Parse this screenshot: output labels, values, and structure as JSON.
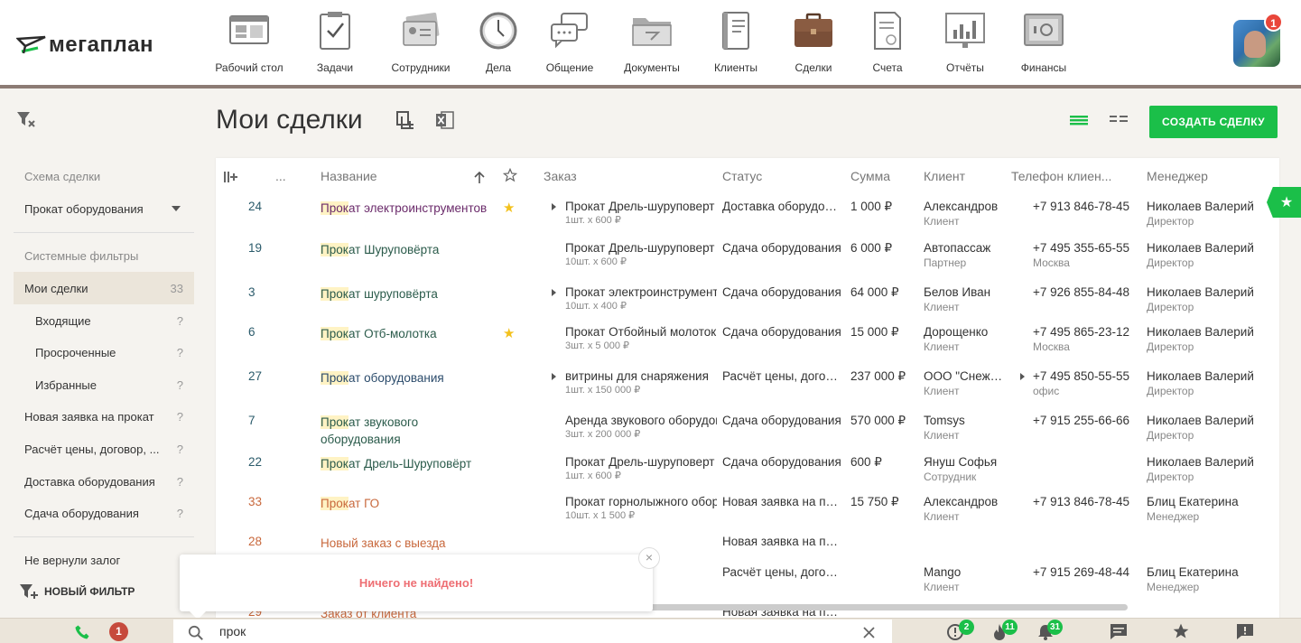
{
  "brand": {
    "logo_text": "мегаплан"
  },
  "nav": [
    {
      "label": "Рабочий стол",
      "icon": "desktop-icon"
    },
    {
      "label": "Задачи",
      "icon": "tasks-icon"
    },
    {
      "label": "Сотрудники",
      "icon": "employees-icon"
    },
    {
      "label": "Дела",
      "icon": "clock-icon"
    },
    {
      "label": "Общение",
      "icon": "chat-icon"
    },
    {
      "label": "Документы",
      "icon": "folder-icon"
    },
    {
      "label": "Клиенты",
      "icon": "contacts-book-icon"
    },
    {
      "label": "Сделки",
      "icon": "briefcase-icon",
      "active": true
    },
    {
      "label": "Счета",
      "icon": "invoice-icon"
    },
    {
      "label": "Отчёты",
      "icon": "report-chart-icon"
    },
    {
      "label": "Финансы",
      "icon": "safe-icon"
    }
  ],
  "user": {
    "notifications": "1"
  },
  "sidebar": {
    "scheme_label": "Схема сделки",
    "scheme_value": "Прокат оборудования",
    "system_filters_label": "Системные фильтры",
    "items": [
      {
        "label": "Мои сделки",
        "count": "33"
      },
      {
        "label": "Входящие",
        "count": "?"
      },
      {
        "label": "Просроченные",
        "count": "?"
      },
      {
        "label": "Избранные",
        "count": "?"
      },
      {
        "label": "Новая заявка на прокат",
        "count": "?"
      },
      {
        "label": "Расчёт цены, договор, ...",
        "count": "?"
      },
      {
        "label": "Доставка оборудования",
        "count": "?"
      },
      {
        "label": "Сдача оборудования",
        "count": "?"
      },
      {
        "label": "Не вернули залог",
        "count": "?"
      }
    ],
    "new_filter": "НОВЫЙ ФИЛЬТР"
  },
  "main": {
    "title": "Мои сделки",
    "create_button": "СОЗДАТЬ СДЕЛКУ"
  },
  "table": {
    "headers": {
      "more": "...",
      "name": "Название",
      "order": "Заказ",
      "status": "Статус",
      "sum": "Сумма",
      "client": "Клиент",
      "phone": "Телефон клиен...",
      "manager": "Менеджер"
    },
    "rows": [
      {
        "id": "24",
        "name_hl": "Прок",
        "name_rest": "ат электроинструментов",
        "name_color": "#6a2a6a",
        "starred": true,
        "order_arrow": true,
        "order": "Прокат Дрель-шуруповерт",
        "order_qty": "1шт. x 600 ₽",
        "status": "Доставка оборудования",
        "sum": "1 000 ₽",
        "client": "Александров",
        "client_type": "Клиент",
        "phone_arrow": false,
        "phone": "+7 913 846-78-45",
        "phone_type": "",
        "manager": "Николаев Валерий",
        "manager_role": "Директор"
      },
      {
        "id": "19",
        "name_hl": "Прок",
        "name_rest": "ат Шуруповёрта",
        "name_color": "#2b5b4b",
        "starred": false,
        "order_arrow": false,
        "order": "Прокат Дрель-шуруповерт",
        "order_qty": "10шт. x 600 ₽",
        "status": "Сдача оборудования",
        "sum": "6 000 ₽",
        "client": "Автопассаж",
        "client_type": "Партнер",
        "phone_arrow": false,
        "phone": "+7 495 355-65-55",
        "phone_type": "Москва",
        "manager": "Николаев Валерий",
        "manager_role": "Директор"
      },
      {
        "id": "3",
        "name_hl": "Прок",
        "name_rest": "ат шуруповёрта",
        "name_color": "#2b5b4b",
        "starred": false,
        "order_arrow": true,
        "order": "Прокат электроинструмента",
        "order_qty": "10шт. x 400 ₽",
        "status": "Сдача оборудования",
        "sum": "64 000 ₽",
        "client": "Белов Иван",
        "client_type": "Клиент",
        "phone_arrow": false,
        "phone": "+7 926 855-84-48",
        "phone_type": "",
        "manager": "Николаев Валерий",
        "manager_role": "Директор"
      },
      {
        "id": "6",
        "name_hl": "Прок",
        "name_rest": "ат Отб-молотка",
        "name_color": "#2b5b4b",
        "starred": true,
        "order_arrow": false,
        "order": "Прокат Отбойный молоток",
        "order_qty": "3шт. x 5 000 ₽",
        "status": "Сдача оборудования",
        "sum": "15 000 ₽",
        "client": "Дорощенко",
        "client_type": "Клиент",
        "phone_arrow": false,
        "phone": "+7 495 865-23-12",
        "phone_type": "Москва",
        "manager": "Николаев Валерий",
        "manager_role": "Директор"
      },
      {
        "id": "27",
        "name_hl": "Прок",
        "name_rest": "ат оборудования",
        "name_color": "#2b4b6b",
        "starred": false,
        "order_arrow": true,
        "order": "витрины для снаряжения",
        "order_qty": "1шт. x 150 000 ₽",
        "status": "Расчёт цены, договор",
        "sum": "237 000 ₽",
        "client": "ООО \"Снежок\"",
        "client_type": "Клиент",
        "phone_arrow": true,
        "phone": "+7 495 850-55-55",
        "phone_type": "офис",
        "manager": "Николаев Валерий",
        "manager_role": "Директор"
      },
      {
        "id": "7",
        "name_hl": "Прок",
        "name_rest": "ат звукового оборудования",
        "name_color": "#2b5b4b",
        "starred": false,
        "order_arrow": false,
        "order": "Аренда звукового оборудования",
        "order_qty": "3шт. x 200 000 ₽",
        "status": "Сдача оборудования",
        "sum": "570 000 ₽",
        "client": "Tomsys",
        "client_type": "Клиент",
        "phone_arrow": false,
        "phone": "+7 915 255-66-66",
        "phone_type": "",
        "manager": "Николаев Валерий",
        "manager_role": "Директор"
      },
      {
        "id": "22",
        "name_hl": "Прок",
        "name_rest": "ат Дрель-Шуруповёрт",
        "name_color": "#2b5b4b",
        "starred": false,
        "order_arrow": false,
        "order": "Прокат Дрель-шуруповерт",
        "order_qty": "1шт. x 600 ₽",
        "status": "Сдача оборудования",
        "sum": "600 ₽",
        "client": "Януш Софья",
        "client_type": "Сотрудник",
        "phone_arrow": false,
        "phone": "",
        "phone_type": "",
        "manager": "Николаев Валерий",
        "manager_role": "Директор"
      },
      {
        "id": "33",
        "name_hl": "Прок",
        "name_rest": "ат ГО",
        "name_color": "#c8683c",
        "id_color": "#c8683c",
        "starred": false,
        "order_arrow": false,
        "order": "Прокат горнолыжного оборудования",
        "order_qty": "10шт. x 1 500 ₽",
        "status": "Новая заявка на прокат",
        "sum": "15 750 ₽",
        "client": "Александров",
        "client_type": "Клиент",
        "phone_arrow": false,
        "phone": "+7 913 846-78-45",
        "phone_type": "",
        "manager": "Блиц Екатерина",
        "manager_role": "Менеджер"
      },
      {
        "id": "28",
        "name_hl": "",
        "name_rest": "Новый заказ с выезда",
        "name_color": "#c8683c",
        "id_color": "#c8683c",
        "starred": false,
        "order_arrow": false,
        "order": "",
        "order_qty": "",
        "status": "Новая заявка на прокат",
        "sum": "",
        "client": "",
        "client_type": "",
        "phone_arrow": false,
        "phone": "",
        "phone_type": "",
        "manager": "",
        "manager_role": ""
      },
      {
        "id": "",
        "name_hl": "",
        "name_rest": "",
        "name_color": "#2b5b4b",
        "starred": false,
        "order_arrow": false,
        "order": "",
        "order_qty": "",
        "status": "Расчёт цены, договор",
        "sum": "",
        "client": "Mango",
        "client_type": "Клиент",
        "phone_arrow": false,
        "phone": "+7 915 269-48-44",
        "phone_type": "",
        "manager": "Блиц Екатерина",
        "manager_role": "Менеджер"
      },
      {
        "id": "29",
        "name_hl": "",
        "name_rest": "Заказ от клиента",
        "name_color": "#c8683c",
        "id_color": "#c8683c",
        "starred": false,
        "order_arrow": false,
        "order": "",
        "order_qty": "",
        "status": "Новая заявка на прокат",
        "sum": "",
        "client": "",
        "client_type": "",
        "phone_arrow": false,
        "phone": "",
        "phone_type": "",
        "manager": "",
        "manager_role": ""
      }
    ]
  },
  "popup": {
    "message": "Ничего не найдено!"
  },
  "bottom": {
    "calls_badge": "1",
    "search_value": "прок",
    "alerts_badge": "2",
    "fire_badge": "11",
    "bell_badge": "31"
  },
  "colors": {
    "accent": "#1bbf49",
    "header_border": "#8c7b74"
  }
}
